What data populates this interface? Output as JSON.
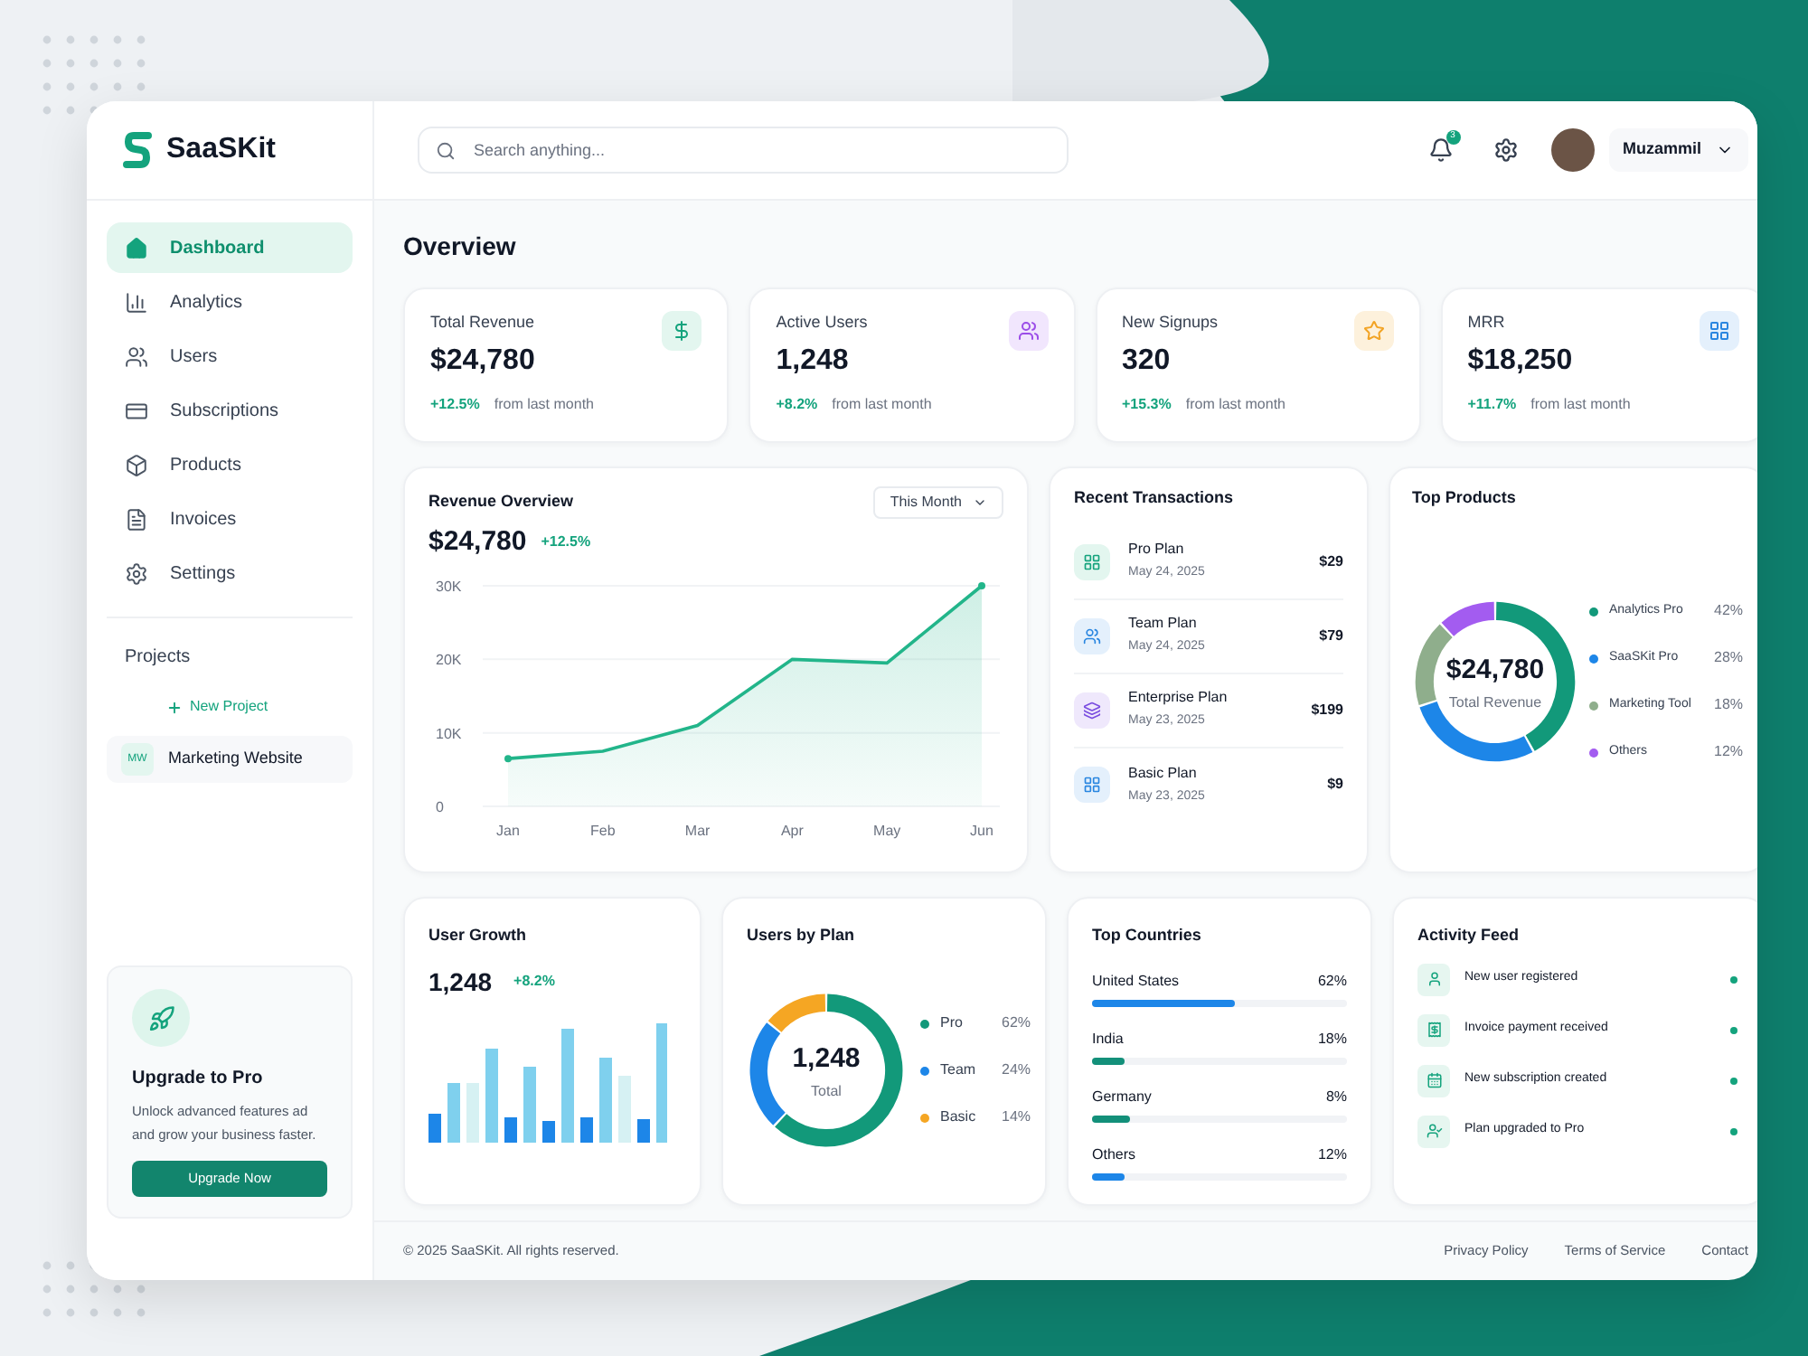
{
  "brand": {
    "name": "SaaSKit"
  },
  "sidebar": {
    "items": [
      {
        "label": "Dashboard",
        "selected": true
      },
      {
        "label": "Analytics",
        "selected": false
      },
      {
        "label": "Users",
        "selected": false
      },
      {
        "label": "Subscriptions",
        "selected": false
      },
      {
        "label": "Products",
        "selected": false
      },
      {
        "label": "Invoices",
        "selected": false
      },
      {
        "label": "Settings",
        "selected": false
      }
    ],
    "projects_heading": "Projects",
    "new_project": "New Project",
    "projects": [
      {
        "initials": "MW",
        "name": "Marketing Website"
      }
    ]
  },
  "upgrade": {
    "title": "Upgrade to Pro",
    "text": "Unlock advanced features ad and grow your business faster.",
    "button": "Upgrade Now"
  },
  "header": {
    "search_placeholder": "Search anything...",
    "notification_count": "3",
    "user_name": "Muzammil"
  },
  "page_title": "Overview",
  "stats": [
    {
      "label": "Total Revenue",
      "value": "$24,780",
      "change": "+12.5%",
      "note": "from last month"
    },
    {
      "label": "Active Users",
      "value": "1,248",
      "change": "+8.2%",
      "note": "from last month"
    },
    {
      "label": "New Signups",
      "value": "320",
      "change": "+15.3%",
      "note": "from last month"
    },
    {
      "label": "MRR",
      "value": "$18,250",
      "change": "+11.7%",
      "note": "from last month"
    }
  ],
  "revenue": {
    "title": "Revenue Overview",
    "period": "This Month",
    "value": "$24,780",
    "change": "+12.5%",
    "chart_data": {
      "type": "area",
      "categories": [
        "Jan",
        "Feb",
        "Mar",
        "Apr",
        "May",
        "Jun"
      ],
      "values": [
        6500,
        7500,
        11000,
        20000,
        19500,
        30000
      ],
      "ylim": [
        0,
        30000
      ],
      "yticks": [
        {
          "value": 0,
          "label": "0"
        },
        {
          "value": 10000,
          "label": "10K"
        },
        {
          "value": 20000,
          "label": "20K"
        },
        {
          "value": 30000,
          "label": "30K"
        }
      ]
    }
  },
  "transactions": {
    "title": "Recent Transactions",
    "items": [
      {
        "name": "Pro Plan",
        "date": "May 24, 2025",
        "amount": "$29"
      },
      {
        "name": "Team Plan",
        "date": "May 24, 2025",
        "amount": "$79"
      },
      {
        "name": "Enterprise Plan",
        "date": "May 23, 2025",
        "amount": "$199"
      },
      {
        "name": "Basic Plan",
        "date": "May 23, 2025",
        "amount": "$9"
      }
    ]
  },
  "top_products": {
    "title": "Top Products",
    "center_value": "$24,780",
    "center_label": "Total Revenue",
    "legend": [
      {
        "share": "42%",
        "color": "#12997a"
      },
      {
        "share": "28%",
        "color": "#1d86e8"
      },
      {
        "share": "18%",
        "color": "#8fae8c"
      },
      {
        "share": "12%",
        "color": "#a35cf0"
      }
    ],
    "chart_data": {
      "type": "donut",
      "categories": [
        "Analytics Pro",
        "SaaSKit Pro",
        "Marketing Tool",
        "Others"
      ],
      "values": [
        42,
        28,
        18,
        12
      ]
    }
  },
  "user_growth": {
    "title": "User Growth",
    "value": "1,248",
    "change": "+8.2%"
  },
  "users_by_plan": {
    "title": "Users by Plan",
    "center_value": "1,248",
    "center_label": "Total",
    "legend": [
      {
        "share": "62%",
        "color": "#12997a"
      },
      {
        "share": "24%",
        "color": "#1d86e8"
      },
      {
        "share": "14%",
        "color": "#f5a623"
      }
    ],
    "chart_data": {
      "type": "donut",
      "categories": [
        "Pro",
        "Team",
        "Basic"
      ],
      "values": [
        62,
        24,
        14
      ]
    }
  },
  "countries": {
    "title": "Top Countries",
    "items": [
      {
        "name": "United States",
        "share": "62%",
        "level": 0.56,
        "color": "#1d86e8"
      },
      {
        "name": "India",
        "share": "18%",
        "level": 0.13,
        "color": "#13907a"
      },
      {
        "name": "Germany",
        "share": "8%",
        "level": 0.15,
        "color": "#13907a"
      },
      {
        "name": "Others",
        "share": "12%",
        "level": 0.13,
        "color": "#1d86e8"
      }
    ]
  },
  "activity": {
    "title": "Activity Feed",
    "items": [
      {
        "text": "New user registered"
      },
      {
        "text": "Invoice payment received"
      },
      {
        "text": "New subscription created"
      },
      {
        "text": "Plan upgraded to Pro"
      }
    ]
  },
  "footer": {
    "copyright": "© 2025 SaaSKit. All rights reserved.",
    "links": [
      "Privacy Policy",
      "Terms of Service",
      "Contact"
    ]
  }
}
